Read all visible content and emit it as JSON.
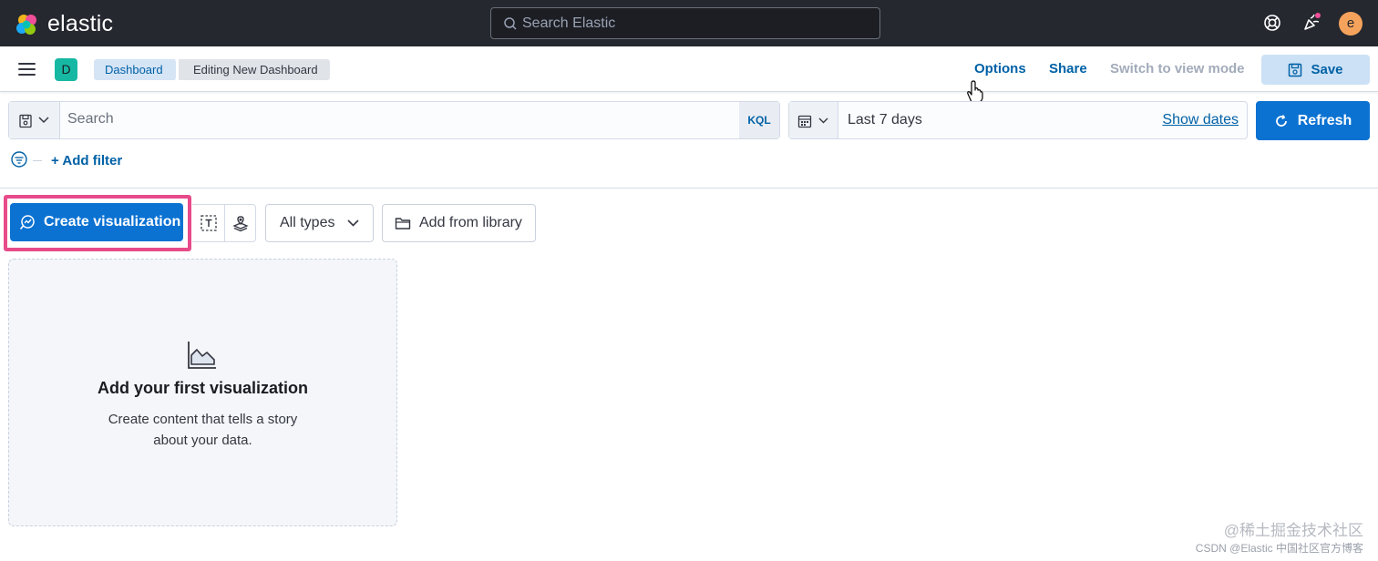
{
  "header": {
    "logo_text": "elastic",
    "search_placeholder": "Search Elastic",
    "avatar_initial": "e",
    "icons": [
      "help-icon",
      "news-feed-icon"
    ]
  },
  "nav": {
    "space_initial": "D",
    "breadcrumbs": [
      "Dashboard",
      "Editing New Dashboard"
    ],
    "options": "Options",
    "share": "Share",
    "switch_view": "Switch to view mode",
    "save": "Save"
  },
  "query": {
    "search_placeholder": "Search",
    "language": "KQL",
    "date_range": "Last 7 days",
    "show_dates": "Show dates",
    "refresh": "Refresh",
    "add_filter": "+ Add filter"
  },
  "toolbar": {
    "create_visualization": "Create visualization",
    "all_types": "All types",
    "add_from_library": "Add from library"
  },
  "empty_panel": {
    "title": "Add your first visualization",
    "description": "Create content that tells a story about your data."
  },
  "watermark": {
    "line1": "@稀土掘金技术社区",
    "line2": "CSDN @Elastic 中国社区官方博客"
  },
  "colors": {
    "header_bg": "#25282f",
    "primary": "#0b72d2",
    "link": "#0061a6",
    "highlight": "#e74b8a"
  }
}
